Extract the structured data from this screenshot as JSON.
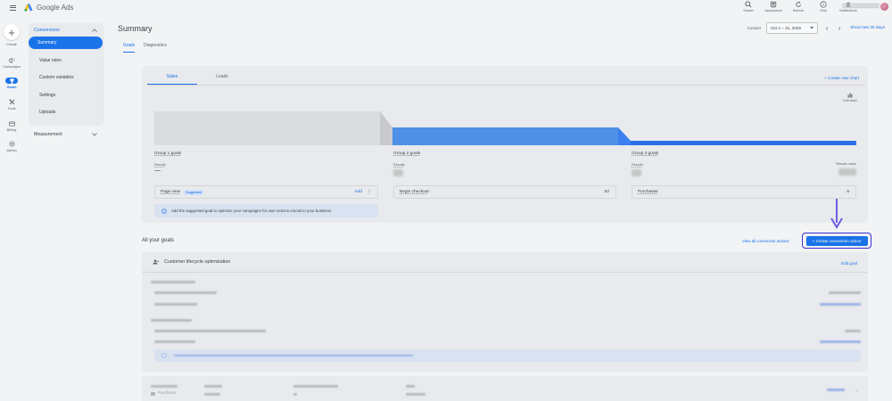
{
  "app": {
    "title": "Google Ads",
    "top_tools": [
      {
        "label": "Search",
        "icon": "search-icon"
      },
      {
        "label": "Appearance",
        "icon": "appearance-icon"
      },
      {
        "label": "Refresh",
        "icon": "refresh-icon"
      },
      {
        "label": "Help",
        "icon": "help-icon"
      },
      {
        "label": "Notifications",
        "icon": "bell-icon"
      }
    ]
  },
  "rail": {
    "create_label": "Create",
    "items": [
      {
        "label": "Campaigns",
        "icon": "campaigns-icon"
      },
      {
        "label": "Goals",
        "icon": "goals-icon"
      },
      {
        "label": "Tools",
        "icon": "tools-icon"
      },
      {
        "label": "Billing",
        "icon": "billing-icon"
      },
      {
        "label": "Admin",
        "icon": "admin-icon"
      }
    ]
  },
  "sidenav": {
    "section": "Conversions",
    "items": [
      "Summary",
      "Value rules",
      "Custom variables",
      "Settings",
      "Uploads"
    ],
    "measurement": "Measurement"
  },
  "page": {
    "title": "Summary",
    "tabs": [
      "Goals",
      "Diagnostics"
    ],
    "date_label": "Custom",
    "date_value": "Oct 1 – 31, 2025",
    "show_last": "Show last 30 days"
  },
  "chart_card": {
    "subtabs": [
      "Sales",
      "Leads"
    ],
    "create_chart": "+ Create new chart",
    "edit_chart": "Edit chart",
    "groups": [
      {
        "title": "Group 1 goals",
        "results_label": "Results",
        "results_value": "—"
      },
      {
        "title": "Group 2 goals",
        "results_label": "Results"
      },
      {
        "title": "Group 3 goals",
        "results_label": "Results",
        "result_value_label": "Results value"
      }
    ],
    "goal_rows": [
      {
        "name": "Page view",
        "badge": "Suggested",
        "action": "Add"
      },
      {
        "name": "Begin checkout",
        "count": "52"
      },
      {
        "name": "Purchases",
        "count": "6"
      }
    ],
    "info": "Add the suggested goal to optimize your campaigns for user actions crucial to your business"
  },
  "all_goals": {
    "heading": "All your goals",
    "view_all": "View all conversion actions",
    "create_button": "+ Create conversion action"
  },
  "lifecycle": {
    "title": "Customer lifecycle optimization",
    "edit": "Edit goal"
  },
  "bottom_row": {
    "name": "Purchase"
  },
  "colors": {
    "accent": "#1a73e8",
    "highlight_border": "#3b2fd1",
    "arrow": "#6c5ce7",
    "funnel_gray": "#dadce0",
    "funnel_blue_light": "#4f8fe6",
    "funnel_blue_mid": "#3d7ff0",
    "funnel_blue_dark": "#2b6fe8"
  }
}
